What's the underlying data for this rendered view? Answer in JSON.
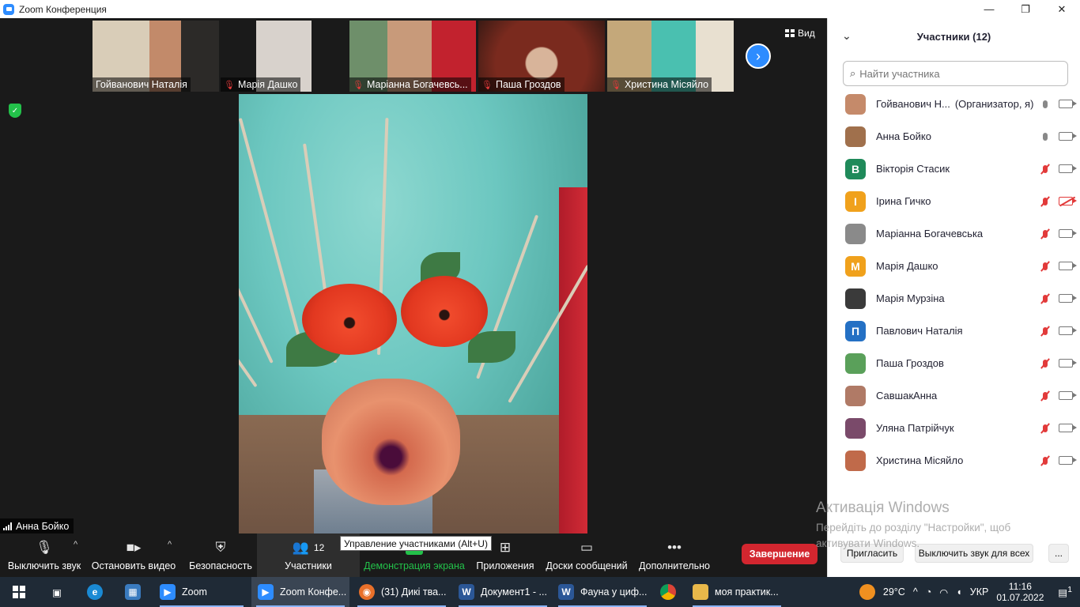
{
  "window": {
    "title": "Zoom Конференция",
    "minimize": "—",
    "maximize": "❐",
    "close": "✕"
  },
  "gallery": {
    "thumbs": [
      {
        "name": "Гойванович Наталія",
        "muted": false
      },
      {
        "name": "Марія Дашко",
        "muted": true
      },
      {
        "name": "Маріанна Богачевсь...",
        "muted": true
      },
      {
        "name": "Паша Гроздов",
        "muted": true
      },
      {
        "name": "Христина Місяйло",
        "muted": true
      }
    ],
    "next_arrow": "›",
    "view_label": "Вид"
  },
  "active_speaker": {
    "name": "Анна Бойко"
  },
  "toolbar": {
    "mute": "Выключить звук",
    "stop_video": "Остановить видео",
    "security": "Безопасность",
    "participants": "Участники",
    "participants_count": "12",
    "share": "Демонстрация экрана",
    "apps": "Приложения",
    "whiteboards": "Доски сообщений",
    "more": "Дополнительно",
    "tooltip": "Управление участниками (Alt+U)",
    "end": "Завершение"
  },
  "panel": {
    "title": "Участники (12)",
    "search_placeholder": "Найти участника",
    "participants": [
      {
        "name": "Гойванович Н...",
        "role": "(Организатор, я)",
        "avatar": "",
        "avatar_color": "#c58a6a",
        "mic_muted": false,
        "cam_off": false
      },
      {
        "name": "Анна Бойко",
        "role": "",
        "avatar": "",
        "avatar_color": "#a0704c",
        "mic_muted": false,
        "cam_off": false
      },
      {
        "name": "Вікторія Стасик",
        "role": "",
        "avatar": "В",
        "avatar_color": "#1f8a5a",
        "mic_muted": true,
        "cam_off": false
      },
      {
        "name": "Ірина Гичко",
        "role": "",
        "avatar": "І",
        "avatar_color": "#f0a11c",
        "mic_muted": true,
        "cam_off": true
      },
      {
        "name": "Маріанна Богачевська",
        "role": "",
        "avatar": "",
        "avatar_color": "#8a8a8a",
        "mic_muted": true,
        "cam_off": false
      },
      {
        "name": "Марія Дашко",
        "role": "",
        "avatar": "М",
        "avatar_color": "#f0a11c",
        "mic_muted": true,
        "cam_off": false
      },
      {
        "name": "Марія Мурзіна",
        "role": "",
        "avatar": "",
        "avatar_color": "#3a3a3a",
        "mic_muted": true,
        "cam_off": false
      },
      {
        "name": "Павлович Наталія",
        "role": "",
        "avatar": "П",
        "avatar_color": "#2470c4",
        "mic_muted": true,
        "cam_off": false
      },
      {
        "name": "Паша Гроздов",
        "role": "",
        "avatar": "",
        "avatar_color": "#5aa05a",
        "mic_muted": true,
        "cam_off": false
      },
      {
        "name": "СавшакАнна",
        "role": "",
        "avatar": "",
        "avatar_color": "#b07a66",
        "mic_muted": true,
        "cam_off": false
      },
      {
        "name": "Уляна Патрійчук",
        "role": "",
        "avatar": "",
        "avatar_color": "#7a4a6a",
        "mic_muted": true,
        "cam_off": false
      },
      {
        "name": "Христина Місяйло",
        "role": "",
        "avatar": "",
        "avatar_color": "#c06a4a",
        "mic_muted": true,
        "cam_off": false
      }
    ],
    "invite": "Пригласить",
    "unmute_all": "Выключить звук для всех",
    "more": "..."
  },
  "activation": {
    "line1": "Активація Windows",
    "line2": "Перейдіть до розділу \"Настройки\", щоб",
    "line3": "активувати Windows."
  },
  "taskbar": {
    "zoom": "Zoom",
    "zoom_meeting": "Zoom Конфе...",
    "firefox": "(31) Дикі тва...",
    "word1": "Документ1 - ...",
    "word2": "Фауна у циф...",
    "folder": "моя практик...",
    "temperature": "29°C",
    "lang": "УКР",
    "time": "11:16",
    "date": "01.07.2022",
    "notifications": "1"
  }
}
